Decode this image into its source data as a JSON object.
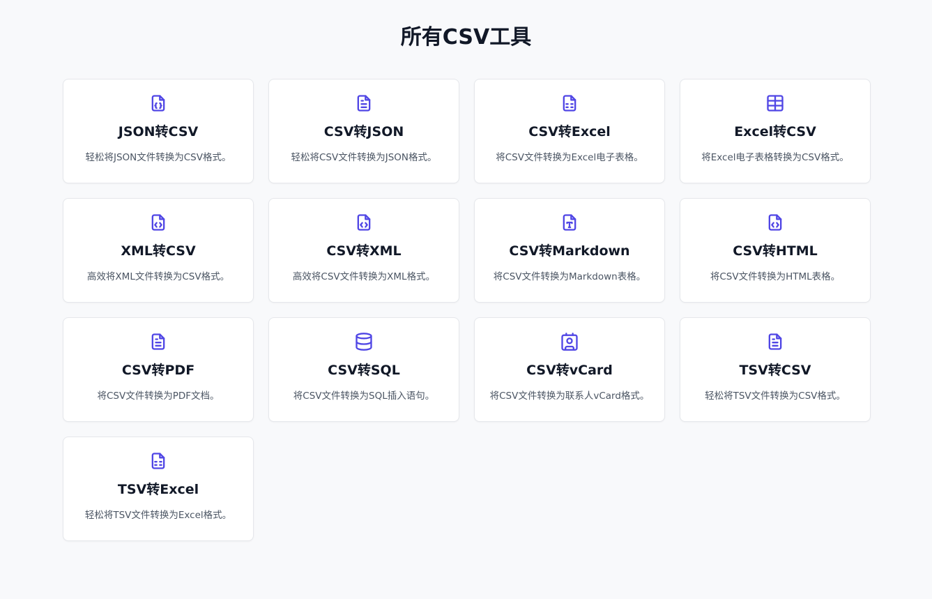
{
  "page": {
    "title": "所有CSV工具"
  },
  "colors": {
    "accent": "#5046e5",
    "background": "#f8f9fb",
    "card": "#ffffff",
    "border": "#e5e7eb"
  },
  "tools": [
    {
      "icon": "file-json-icon",
      "title": "JSON转CSV",
      "desc": "轻松将JSON文件转换为CSV格式。"
    },
    {
      "icon": "file-text-icon",
      "title": "CSV转JSON",
      "desc": "轻松将CSV文件转换为JSON格式。"
    },
    {
      "icon": "file-spreadsheet-icon",
      "title": "CSV转Excel",
      "desc": "将CSV文件转换为Excel电子表格。"
    },
    {
      "icon": "table-icon",
      "title": "Excel转CSV",
      "desc": "将Excel电子表格转换为CSV格式。"
    },
    {
      "icon": "file-code-icon",
      "title": "XML转CSV",
      "desc": "高效将XML文件转换为CSV格式。"
    },
    {
      "icon": "file-code-icon",
      "title": "CSV转XML",
      "desc": "高效将CSV文件转换为XML格式。"
    },
    {
      "icon": "file-type-icon",
      "title": "CSV转Markdown",
      "desc": "将CSV文件转换为Markdown表格。"
    },
    {
      "icon": "file-code-icon",
      "title": "CSV转HTML",
      "desc": "将CSV文件转换为HTML表格。"
    },
    {
      "icon": "file-text-icon",
      "title": "CSV转PDF",
      "desc": "将CSV文件转换为PDF文档。"
    },
    {
      "icon": "database-icon",
      "title": "CSV转SQL",
      "desc": "将CSV文件转换为SQL插入语句。"
    },
    {
      "icon": "contact-icon",
      "title": "CSV转vCard",
      "desc": "将CSV文件转换为联系人vCard格式。"
    },
    {
      "icon": "file-text-icon",
      "title": "TSV转CSV",
      "desc": "轻松将TSV文件转换为CSV格式。"
    },
    {
      "icon": "file-spreadsheet-icon",
      "title": "TSV转Excel",
      "desc": "轻松将TSV文件转换为Excel格式。"
    }
  ]
}
